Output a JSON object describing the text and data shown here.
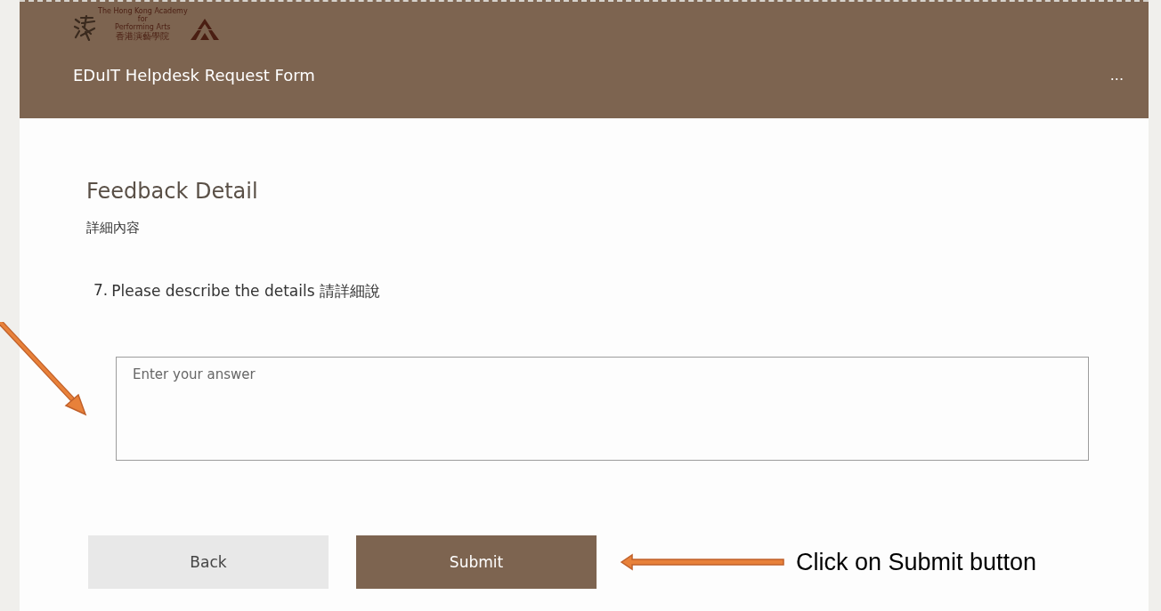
{
  "header": {
    "logo_text": [
      "The Hong Kong Academy",
      "for",
      "Performing Arts"
    ],
    "logo_chinese": "香港演藝學院",
    "title": "EDuIT Helpdesk Request Form",
    "more": "..."
  },
  "section": {
    "title": "Feedback Detail",
    "subtitle": "詳細內容"
  },
  "question": {
    "number": "7.",
    "text": "Please describe the details 請詳細說",
    "placeholder": "Enter your answer"
  },
  "buttons": [
    {
      "label": "Back",
      "kind": "secondary"
    },
    {
      "label": "Submit",
      "kind": "primary"
    }
  ],
  "annotation": {
    "text": "Click on Submit button"
  }
}
